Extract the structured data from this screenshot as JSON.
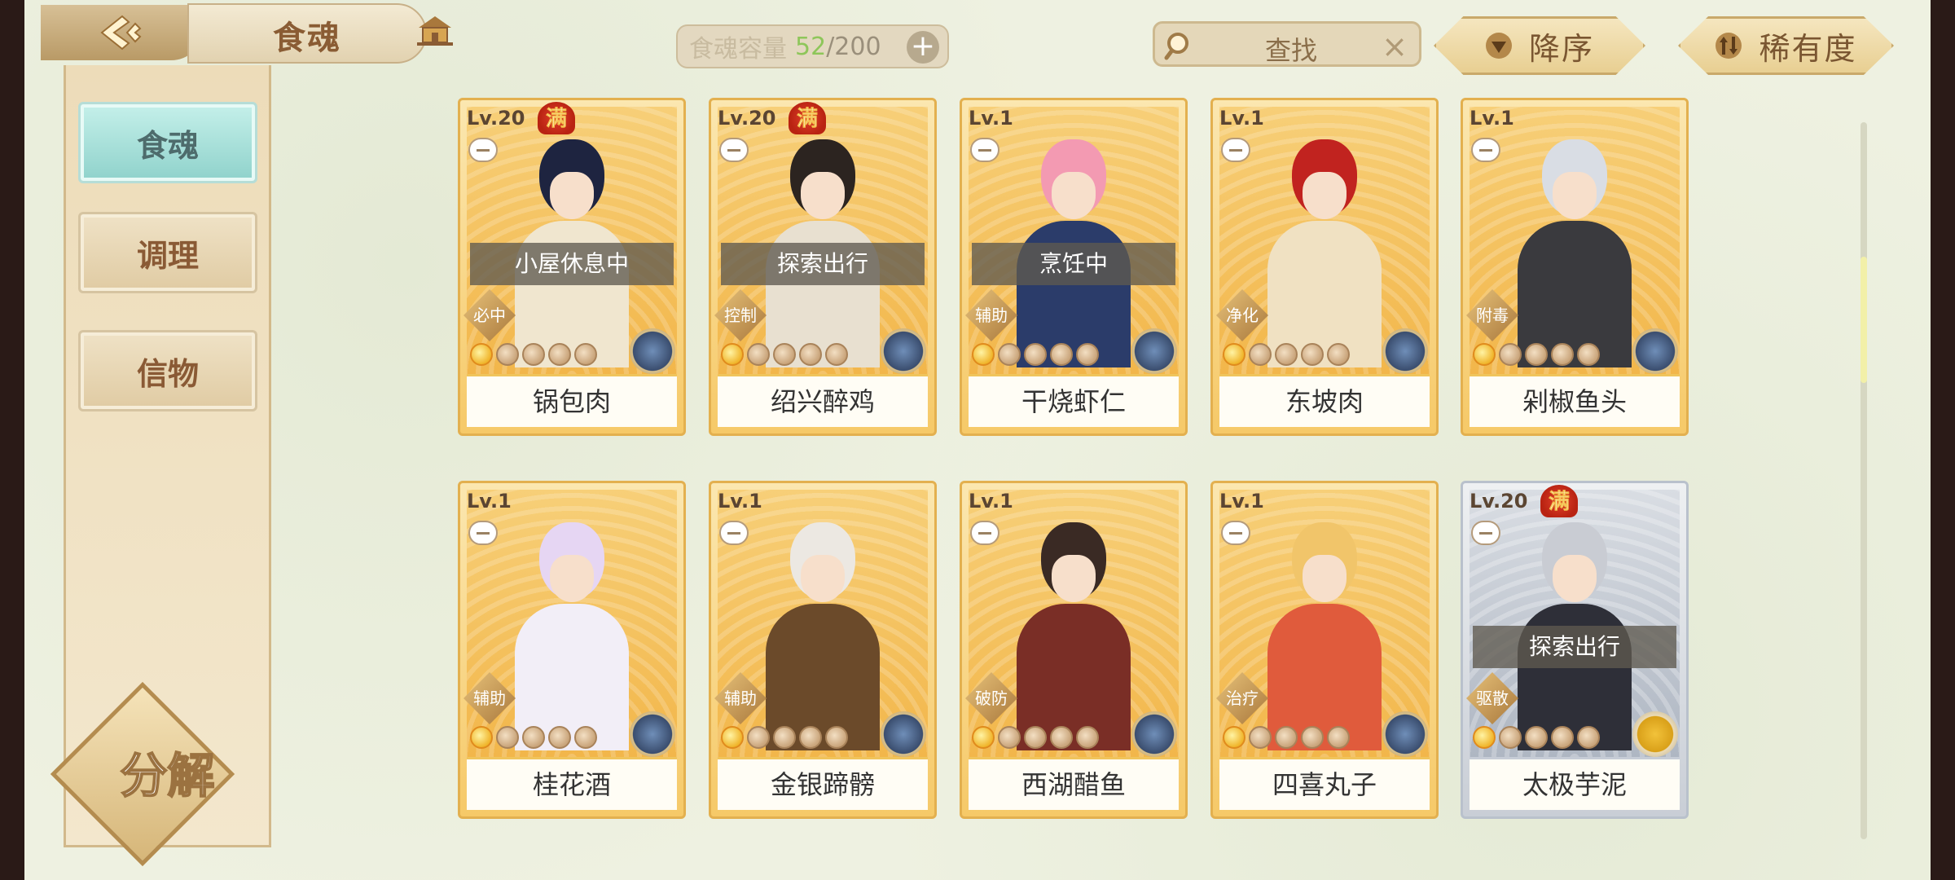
{
  "header": {
    "title": "食魂",
    "capacity_label": "食魂容量",
    "capacity_current": "52",
    "capacity_max": "/200",
    "capacity_add": "+",
    "search_text": "查找",
    "search_clear": "×",
    "sort_order_label": "降序",
    "sort_by_label": "稀有度"
  },
  "sidebar": {
    "tabs": [
      {
        "label": "食魂",
        "active": true
      },
      {
        "label": "调理",
        "active": false
      },
      {
        "label": "信物",
        "active": false
      }
    ],
    "decompose_label": "分解"
  },
  "cards": [
    {
      "level": "Lv.20",
      "max": "满",
      "status": "小屋休息中",
      "role": "必中",
      "name": "锅包肉",
      "stars_on": 1,
      "element": "water"
    },
    {
      "level": "Lv.20",
      "max": "满",
      "status": "探索出行",
      "role": "控制",
      "name": "绍兴醉鸡",
      "stars_on": 1,
      "element": "water"
    },
    {
      "level": "Lv.1",
      "max": "",
      "status": "烹饪中",
      "role": "辅助",
      "name": "干烧虾仁",
      "stars_on": 1,
      "element": "water"
    },
    {
      "level": "Lv.1",
      "max": "",
      "status": "",
      "role": "净化",
      "name": "东坡肉",
      "stars_on": 1,
      "element": "fire"
    },
    {
      "level": "Lv.1",
      "max": "",
      "status": "",
      "role": "附毒",
      "name": "剁椒鱼头",
      "stars_on": 1,
      "element": "water"
    },
    {
      "level": "Lv.1",
      "max": "",
      "status": "",
      "role": "辅助",
      "name": "桂花酒",
      "stars_on": 1,
      "element": "water"
    },
    {
      "level": "Lv.1",
      "max": "",
      "status": "",
      "role": "辅助",
      "name": "金银蹄髈",
      "stars_on": 1,
      "element": "water"
    },
    {
      "level": "Lv.1",
      "max": "",
      "status": "",
      "role": "破防",
      "name": "西湖醋鱼",
      "stars_on": 1,
      "element": "water"
    },
    {
      "level": "Lv.1",
      "max": "",
      "status": "",
      "role": "治疗",
      "name": "四喜丸子",
      "stars_on": 1,
      "element": "water"
    },
    {
      "level": "Lv.20",
      "max": "满",
      "status": "探索出行",
      "role": "驱散",
      "name": "太极芋泥",
      "stars_on": 1,
      "element": "gold",
      "silver": true
    }
  ],
  "colors": {
    "background": "#eef1e1",
    "card_gold": "#f6c968",
    "active_tab": "#8fd2cb",
    "capacity_current": "#8ec65a"
  }
}
